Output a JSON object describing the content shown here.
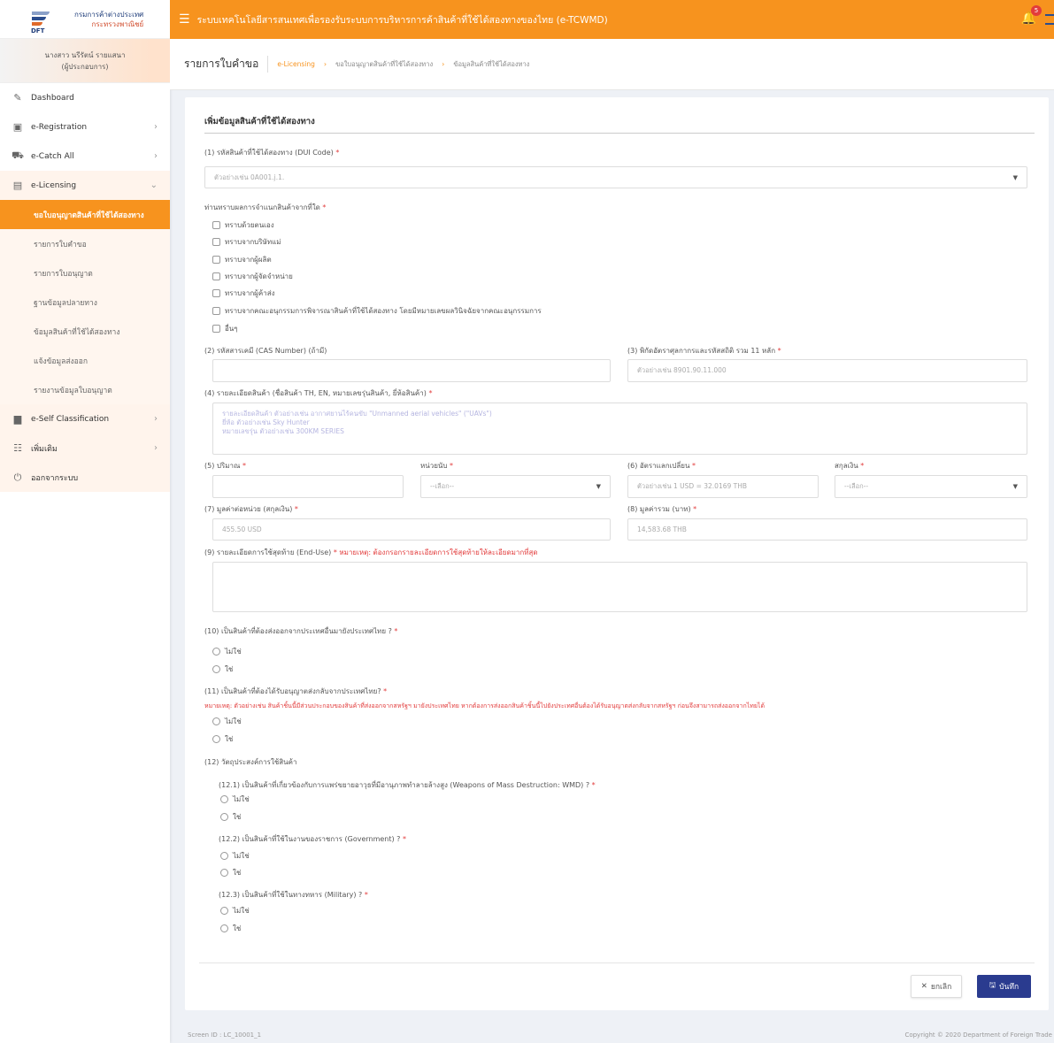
{
  "logo": {
    "name_th": "กรมการค้าต่างประเทศ",
    "ministry": "กระทรวงพาณิชย์",
    "abbr": "DFT"
  },
  "user": {
    "name": "นางสาว นรีรัตน์ รายแสนา",
    "role": "(ผู้ประกอบการ)"
  },
  "sidebar": {
    "items": [
      {
        "label": "Dashboard"
      },
      {
        "label": "e-Registration"
      },
      {
        "label": "e-Catch All"
      },
      {
        "label": "e-Licensing"
      },
      {
        "label": "e-Self Classification"
      },
      {
        "label": "เพิ่มเติม"
      },
      {
        "label": "ออกจากระบบ"
      }
    ],
    "subitems": [
      "ขอใบอนุญาตสินค้าที่ใช้ได้สองทาง",
      "รายการใบคำขอ",
      "รายการใบอนุญาต",
      "ฐานข้อมูลปลายทาง",
      "ข้อมูลสินค้าที่ใช้ได้สองทาง",
      "แจ้งข้อมูลส่งออก",
      "รายงานข้อมูลใบอนุญาต"
    ]
  },
  "topbar": {
    "title": "ระบบเทคโนโลยีสารสนเทศเพื่อรองรับระบบการบริหารการค้าสินค้าที่ใช้ได้สองทางของไทย (e-TCWMD)",
    "notif_count": "5"
  },
  "header": {
    "title": "รายการใบคำขอ",
    "breadcrumb": [
      "e-Licensing",
      "ขอใบอนุญาตสินค้าที่ใช้ได้สองทาง",
      "ข้อมูลสินค้าที่ใช้ได้สองทาง"
    ]
  },
  "form": {
    "section_title": "เพิ่มข้อมูลสินค้าที่ใช้ได้สองทาง",
    "dui_label": "(1) รหัสสินค้าที่ใช้ได้สองทาง (DUI Code)",
    "dui_placeholder": "ตัวอย่างเช่น 0A001.j.1.",
    "classify_label": "ท่านทราบผลการจำแนกสินค้าจากที่ใด",
    "classify_options": [
      "ทราบด้วยตนเอง",
      "ทราบจากบริษัทแม่",
      "ทราบจากผู้ผลิต",
      "ทราบจากผู้จัดจำหน่าย",
      "ทราบจากผู้ค้าส่ง",
      "ทราบจากคณะอนุกรรมการพิจารณาสินค้าที่ใช้ได้สองทาง โดยมีหมายเลขผลวินิจฉัยจากคณะอนุกรรมการ",
      "อื่นๆ"
    ],
    "cas_label": "(2) รหัสสารเคมี (CAS Number) (ถ้ามี)",
    "hs_label": "(3) พิกัดอัตราศุลกากรและรหัสสถิติ รวม 11 หลัก",
    "hs_placeholder": "ตัวอย่างเช่น 8901.90.11.000",
    "desc_label": "(4) รายละเอียดสินค้า (ชื่อสินค้า TH, EN, หมายเลขรุ่นสินค้า, ยี่ห้อสินค้า)",
    "desc_placeholder": [
      "รายละเอียดสินค้า ตัวอย่างเช่น อากาศยานไร้คนขับ \"Unmanned aerial vehicles\" (\"UAVs\")",
      "ยี่ห้อ ตัวอย่างเช่น Sky Hunter",
      "หมายเลขรุ่น ตัวอย่างเช่น 300KM SERIES"
    ],
    "qty_label": "(5) ปริมาณ",
    "unit_label": "หน่วยนับ",
    "unit_value": "--เลือก--",
    "rate_label": "(6) อัตราแลกเปลี่ยน",
    "rate_placeholder": "ตัวอย่างเช่น 1 USD = 32.0169 THB",
    "currency_label": "สกุลเงิน",
    "currency_value": "--เลือก--",
    "unit_price_label": "(7) มูลค่าต่อหน่วย (สกุลเงิน)",
    "unit_price_value": "455.50 USD",
    "total_label": "(8) มูลค่ารวม (บาท)",
    "total_value": "14,583.68 THB",
    "enduse_label": "(9) รายละเอียดการใช้สุดท้าย (End-Use)",
    "enduse_note": "หมายเหตุ: ต้องกรอกรายละเอียดการใช้สุดท้ายให้ละเอียดมากที่สุด",
    "q10": "(10) เป็นสินค้าที่ต้องส่งออกจากประเทศอื่นมายังประเทศไทย ?",
    "q11": "(11) เป็นสินค้าที่ต้องได้รับอนุญาตส่งกลับจากประเทศไทย?",
    "q11_note": "หมายเหตุ: ตัวอย่างเช่น สินค้าชิ้นนี้มีส่วนประกอบของสินค้าที่ส่งออกจากสหรัฐฯ มายังประเทศไทย หากต้องการส่งออกสินค้าชิ้นนี้ไปยังประเทศอื่นต้องได้รับอนุญาตส่งกลับจากสหรัฐฯ ก่อนจึงสามารถส่งออกจากไทยได้",
    "q12": "(12) วัตถุประสงค์การใช้สินค้า",
    "q12_1": "(12.1) เป็นสินค้าที่เกี่ยวข้องกับการแพร่ขยายอาวุธที่มีอานุภาพทำลายล้างสูง (Weapons of Mass Destruction: WMD) ?",
    "q12_2": "(12.2) เป็นสินค้าที่ใช้ในงานของราชการ (Government) ?",
    "q12_3": "(12.3) เป็นสินค้าที่ใช้ในทางทหาร (Military) ?",
    "opt_no": "ไม่ใช่",
    "opt_yes": "ใช่",
    "required_mark": "*",
    "cancel_label": "ยกเลิก",
    "save_label": "บันทึก"
  },
  "footer": {
    "screen_id": "Screen ID : LC_10001_1",
    "copyright": "Copyright © 2020 Department of Foreign Trade"
  }
}
